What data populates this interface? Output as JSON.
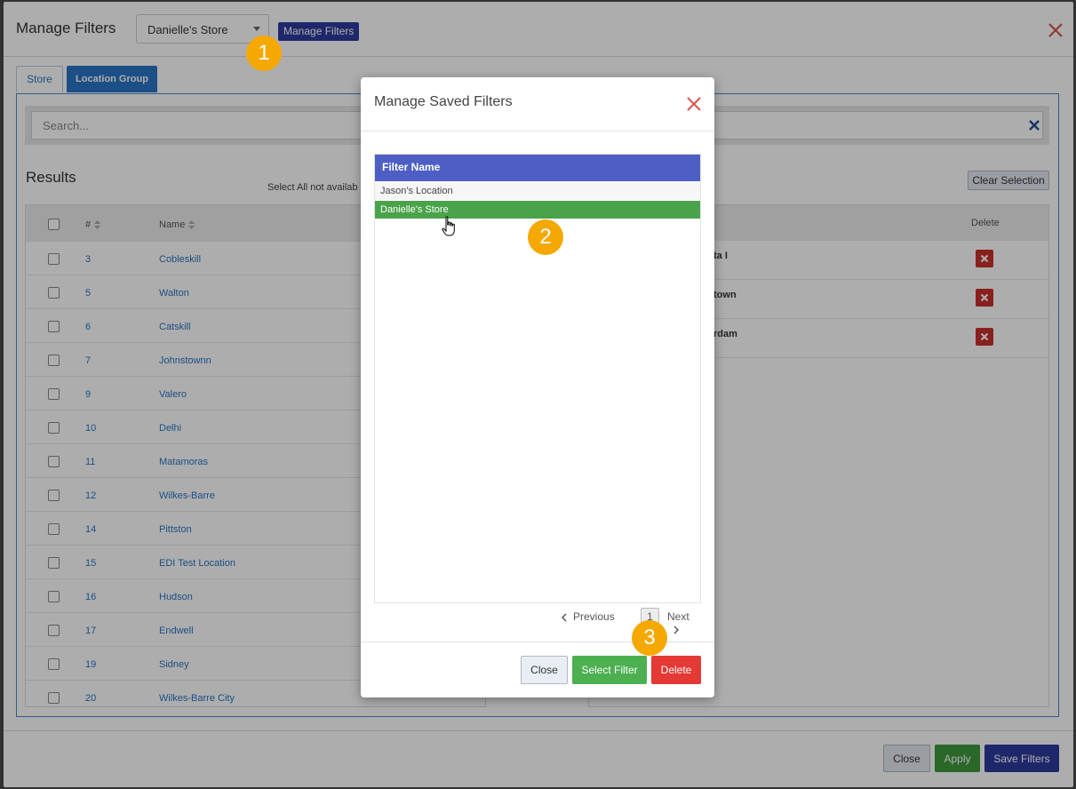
{
  "main_modal": {
    "title": "Manage Filters",
    "store_select": {
      "value": "Danielle's Store"
    },
    "manage_filters_label": "Manage Filters",
    "tabs": [
      {
        "label": "Store"
      },
      {
        "label": "Location Group"
      }
    ],
    "search_placeholder": "Search...",
    "results_title": "Results",
    "select_all_note": "Select All not availab",
    "clear_selection_label": "Clear Selection",
    "table": {
      "headers": {
        "num": "#",
        "name": "Name"
      },
      "rows": [
        {
          "num": "3",
          "name": "Cobleskill"
        },
        {
          "num": "5",
          "name": "Walton"
        },
        {
          "num": "6",
          "name": "Catskill"
        },
        {
          "num": "7",
          "name": "Johnstownn"
        },
        {
          "num": "9",
          "name": "Valero"
        },
        {
          "num": "10",
          "name": "Delhi"
        },
        {
          "num": "11",
          "name": "Matamoras"
        },
        {
          "num": "12",
          "name": "Wilkes-Barre"
        },
        {
          "num": "14",
          "name": "Pittston"
        },
        {
          "num": "15",
          "name": "EDI Test Location"
        },
        {
          "num": "16",
          "name": "Hudson"
        },
        {
          "num": "17",
          "name": "Endwell"
        },
        {
          "num": "19",
          "name": "Sidney"
        },
        {
          "num": "20",
          "name": "Wilkes-Barre City"
        }
      ]
    },
    "selected_table": {
      "delete_header": "Delete",
      "rows": [
        {
          "name": "ta I"
        },
        {
          "name": "town"
        },
        {
          "name": "rdam"
        }
      ]
    },
    "footer": {
      "close_label": "Close",
      "apply_label": "Apply",
      "save_label": "Save Filters"
    }
  },
  "dialog": {
    "title": "Manage Saved Filters",
    "table_header": "Filter Name",
    "filters": [
      {
        "name": "Jason's Location"
      },
      {
        "name": "Danielle's Store"
      }
    ],
    "pager": {
      "previous": "Previous",
      "page": "1",
      "next": "Next"
    },
    "buttons": {
      "close": "Close",
      "select": "Select Filter",
      "delete": "Delete"
    }
  },
  "badges": [
    "1",
    "2",
    "3"
  ],
  "colors": {
    "primary_blue": "#2a75c4",
    "navy": "#2f3a9e",
    "filter_header": "#4d5fc4",
    "selected_row": "#4aa34a",
    "delete_red": "#e53935",
    "badge_orange": "#f5a800"
  }
}
